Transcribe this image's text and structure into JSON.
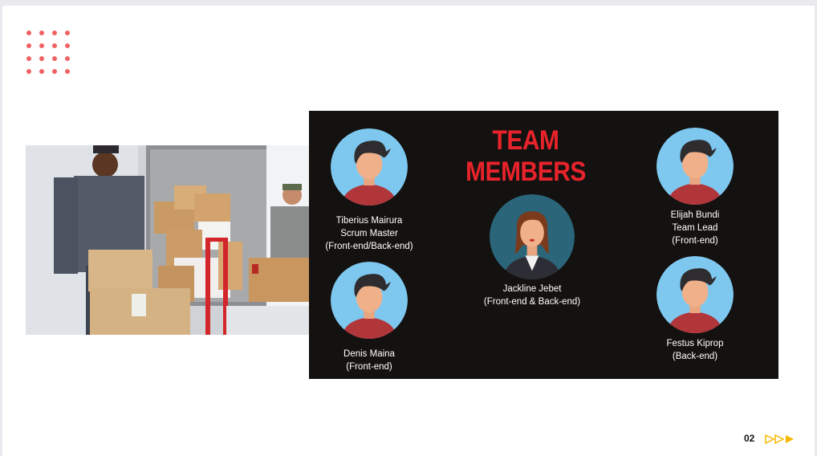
{
  "slide": {
    "title": "TEAM MEMBERS",
    "page_number": "02",
    "accent_color": "#e8232b",
    "dot_color": "#f06262",
    "arrow_color": "#f5b800",
    "panel_color": "#141210"
  },
  "members": [
    {
      "name": "Tiberius Mairura",
      "role": "Scrum Master",
      "stack": "(Front-end/Back-end)",
      "avatar": "male-avatar-icon"
    },
    {
      "name": "Denis Maina",
      "role": "",
      "stack": "(Front-end)",
      "avatar": "male-avatar-icon"
    },
    {
      "name": "Jackline Jebet",
      "role": "",
      "stack": "(Front-end & Back-end)",
      "avatar": "female-avatar-icon"
    },
    {
      "name": "Elijah Bundi",
      "role": "Team Lead",
      "stack": "(Front-end)",
      "avatar": "male-avatar-icon"
    },
    {
      "name": "Festus Kiprop",
      "role": "",
      "stack": "(Back-end)",
      "avatar": "male-avatar-icon"
    }
  ]
}
